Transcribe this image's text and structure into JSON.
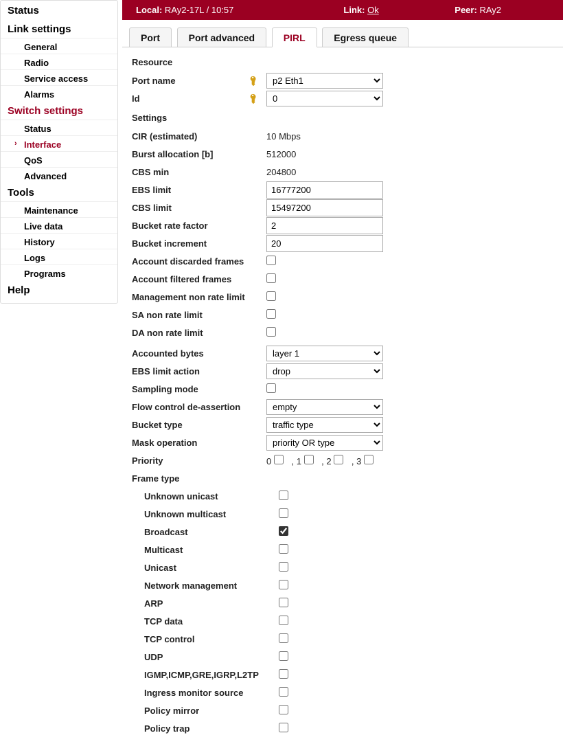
{
  "header": {
    "local_label": "Local:",
    "local_value": "RAy2-17L / 10:57",
    "link_label": "Link:",
    "link_value": "Ok",
    "peer_label": "Peer:",
    "peer_value": "RAy2"
  },
  "sidebar": {
    "status": "Status",
    "link_settings": "Link settings",
    "general": "General",
    "radio": "Radio",
    "service_access": "Service access",
    "alarms": "Alarms",
    "switch_settings": "Switch settings",
    "sw_status": "Status",
    "interface": "Interface",
    "qos": "QoS",
    "advanced": "Advanced",
    "tools": "Tools",
    "maintenance": "Maintenance",
    "live_data": "Live data",
    "history": "History",
    "logs": "Logs",
    "programs": "Programs",
    "help": "Help"
  },
  "tabs": {
    "port": "Port",
    "port_adv": "Port advanced",
    "pirl": "PIRL",
    "egress": "Egress queue"
  },
  "resource": {
    "section": "Resource",
    "port_name_label": "Port name",
    "port_name_value": "p2 Eth1",
    "id_label": "Id",
    "id_value": "0"
  },
  "settings": {
    "section": "Settings",
    "cir_label": "CIR (estimated)",
    "cir_value": "10 Mbps",
    "burst_label": "Burst allocation [b]",
    "burst_value": "512000",
    "cbs_min_label": "CBS min",
    "cbs_min_value": "204800",
    "ebs_limit_label": "EBS limit",
    "ebs_limit_value": "16777200",
    "cbs_limit_label": "CBS limit",
    "cbs_limit_value": "15497200",
    "brf_label": "Bucket rate factor",
    "brf_value": "2",
    "binc_label": "Bucket increment",
    "binc_value": "20",
    "acc_discard_label": "Account discarded frames",
    "acc_filter_label": "Account filtered frames",
    "mgmt_nrl_label": "Management non rate limit",
    "sa_nrl_label": "SA non rate limit",
    "da_nrl_label": "DA non rate limit",
    "acc_bytes_label": "Accounted bytes",
    "acc_bytes_value": "layer 1",
    "ebs_action_label": "EBS limit action",
    "ebs_action_value": "drop",
    "sampling_label": "Sampling mode",
    "fc_deassert_label": "Flow control de-assertion",
    "fc_deassert_value": "empty",
    "bucket_type_label": "Bucket type",
    "bucket_type_value": "traffic type",
    "mask_op_label": "Mask operation",
    "mask_op_value": "priority OR type",
    "priority_label": "Priority",
    "p0": "0",
    "p1": "1",
    "p2": "2",
    "p3": "3",
    "frame_type_label": "Frame type",
    "ft_unknown_uc": "Unknown unicast",
    "ft_unknown_mc": "Unknown multicast",
    "ft_broadcast": "Broadcast",
    "ft_multicast": "Multicast",
    "ft_unicast": "Unicast",
    "ft_netmgmt": "Network management",
    "ft_arp": "ARP",
    "ft_tcp_data": "TCP data",
    "ft_tcp_ctrl": "TCP control",
    "ft_udp": "UDP",
    "ft_igmp": "IGMP,ICMP,GRE,IGRP,L2TP",
    "ft_ingress_mon": "Ingress monitor source",
    "ft_policy_mirror": "Policy mirror",
    "ft_policy_trap": "Policy trap"
  }
}
